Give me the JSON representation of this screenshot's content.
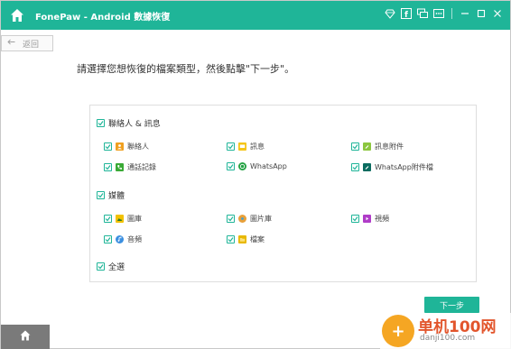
{
  "titlebar": {
    "title": "FonePaw - Android 數據恢復",
    "accent_color": "#1fb598",
    "icons": [
      "diamond-icon",
      "facebook-icon",
      "chat-icon",
      "more-icon",
      "minimize-icon",
      "maximize-icon",
      "close-icon"
    ]
  },
  "back_button": {
    "label": "返回"
  },
  "instruction": "請選擇您想恢復的檔案類型，然後點擊\"下一步\"。",
  "groups": {
    "contacts_messages": {
      "label": "聯絡人 & 訊息",
      "items": {
        "contacts": "聯絡人",
        "messages": "訊息",
        "message_attachments": "訊息附件",
        "call_logs": "通話記錄",
        "whatsapp": "WhatsApp",
        "whatsapp_attachments": "WhatsApp附件檔"
      }
    },
    "media": {
      "label": "媒體",
      "items": {
        "gallery": "圖庫",
        "picture_library": "圖片庫",
        "videos": "視頻",
        "audio": "音頻",
        "documents": "檔案"
      }
    },
    "select_all": {
      "label": "全選"
    }
  },
  "next_button": {
    "label": "下一步"
  },
  "watermark": {
    "title": "单机100网",
    "url": "danji100.com"
  }
}
